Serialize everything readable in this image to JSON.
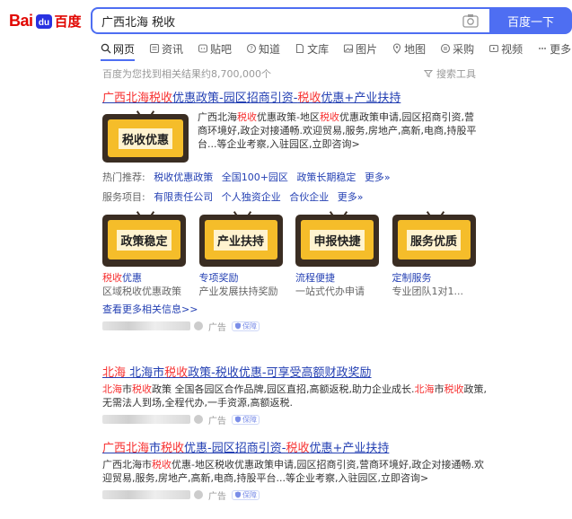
{
  "header": {
    "logo_bai": "Bai",
    "logo_du": "du",
    "logo_cn": "百度",
    "query": "广西北海 税收",
    "search_button": "百度一下"
  },
  "tabs": [
    {
      "label": "网页",
      "icon": "search-icon"
    },
    {
      "label": "资讯",
      "icon": "news-icon"
    },
    {
      "label": "贴吧",
      "icon": "tieba-icon"
    },
    {
      "label": "知道",
      "icon": "zhidao-icon"
    },
    {
      "label": "文库",
      "icon": "wenku-icon"
    },
    {
      "label": "图片",
      "icon": "image-icon"
    },
    {
      "label": "地图",
      "icon": "map-icon"
    },
    {
      "label": "采购",
      "icon": "purchase-icon"
    },
    {
      "label": "视频",
      "icon": "video-icon"
    },
    {
      "label": "更多",
      "icon": "more-icon"
    }
  ],
  "result_count": "百度为您找到相关结果约8,700,000个",
  "search_tools": "搜索工具",
  "r1": {
    "title_hl1": "广西北海税收",
    "title_mid": "优惠政策-园区招商引资-",
    "title_hl2": "税收",
    "title_end": "优惠+产业扶持",
    "image_text": "税收优惠",
    "desc_1": "广西北海",
    "desc_hl1": "税收",
    "desc_2": "优惠政策-地区",
    "desc_hl2": "税收",
    "desc_3": "优惠政策申请,园区招商引资,营商环境好,政企对接通畅.欢迎贸易,服务,房地产,高新,电商,持股平台...等企业考察,入驻园区,立即咨询>",
    "hot_label": "热门推荐:",
    "hot_links": [
      "税收优惠政策",
      "全国100+园区",
      "政策长期稳定",
      "更多»"
    ],
    "svc_label": "服务项目:",
    "svc_links": [
      "有限责任公司",
      "个人独资企业",
      "合伙企业",
      "更多»"
    ],
    "cards": [
      {
        "img": "政策稳定",
        "title_hl": "税收",
        "title": "优惠",
        "desc": "区域税收优惠政策"
      },
      {
        "img": "产业扶持",
        "title_hl": "",
        "title": "专项奖励",
        "desc": "产业发展扶持奖励"
      },
      {
        "img": "申报快捷",
        "title_hl": "",
        "title": "流程便捷",
        "desc": "一站式代办申请"
      },
      {
        "img": "服务优质",
        "title_hl": "",
        "title": "定制服务",
        "desc": "专业团队1对1..."
      }
    ],
    "more": "查看更多相关信息>>",
    "ad": "广告",
    "badge": "保障"
  },
  "r2": {
    "title_hl1": "北海",
    "title_mid": " 北海市",
    "title_hl2": "税收",
    "title_end": "政策-税收优惠-可享受高额财政奖励",
    "desc_hl1": "北海",
    "desc_1": "市",
    "desc_hl2": "税收",
    "desc_2": "政策 全国各园区合作品牌,园区直招,高额返税,助力企业成长.",
    "desc_hl3": "北海",
    "desc_3": "市",
    "desc_hl4": "税收",
    "desc_4": "政策,无需法人到场,全程代办,一手资源,高额返税.",
    "ad": "广告",
    "badge": "保障"
  },
  "r3": {
    "title_hl1": "广西北海",
    "title_mid": "市",
    "title_hl2": "税收",
    "title_mid2": "优惠-园区招商引资-",
    "title_hl3": "税收",
    "title_end": "优惠+产业扶持",
    "desc_1": "广西北海市",
    "desc_hl1": "税收",
    "desc_2": "优惠-地区税收优惠政策申请,园区招商引资,营商环境好,政企对接通畅.欢迎贸易,服务,房地产,高新,电商,持股平台...等企业考察,入驻园区,立即咨询>",
    "ad": "广告",
    "badge": "保障"
  },
  "colors": {
    "brand_red": "#e10601",
    "accent_blue": "#4e6ef2",
    "link": "#2440b3",
    "highlight": "#f73131"
  }
}
